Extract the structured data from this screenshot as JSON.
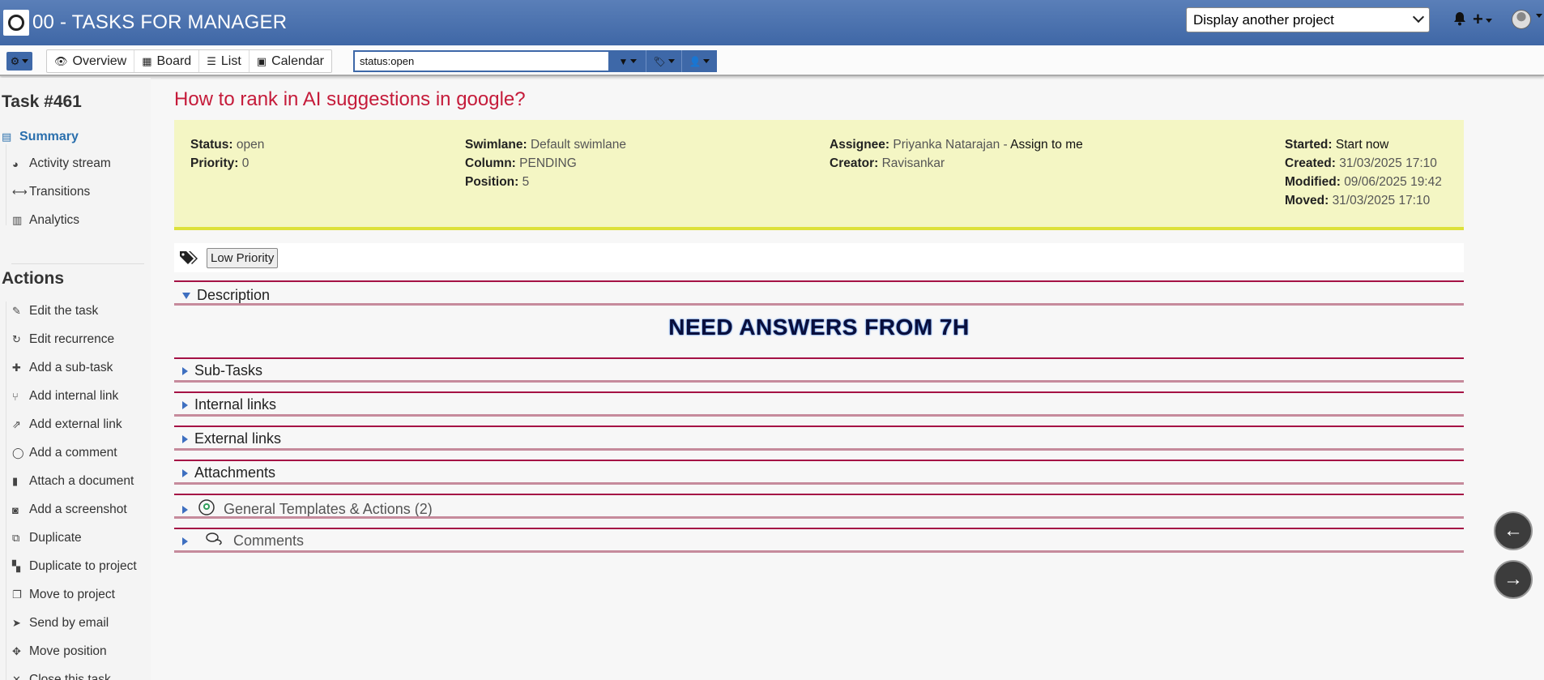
{
  "header": {
    "project_title": "00 - TASKS FOR MANAGER",
    "project_select": "Display another project"
  },
  "toolbar": {
    "views": [
      {
        "icon": "eye-icon",
        "label": "Overview"
      },
      {
        "icon": "board-icon",
        "label": "Board"
      },
      {
        "icon": "list-icon",
        "label": "List"
      },
      {
        "icon": "calendar-icon",
        "label": "Calendar"
      }
    ],
    "search_value": "status:open"
  },
  "sidebar": {
    "task_id": "Task #461",
    "summary_label": "Summary",
    "info_links": [
      "Activity stream",
      "Transitions",
      "Analytics"
    ],
    "actions_title": "Actions",
    "actions": [
      "Edit the task",
      "Edit recurrence",
      "Add a sub-task",
      "Add internal link",
      "Add external link",
      "Add a comment",
      "Attach a document",
      "Add a screenshot",
      "Duplicate",
      "Duplicate to project",
      "Move to project",
      "Send by email",
      "Move position",
      "Close this task"
    ]
  },
  "task": {
    "title": "How to rank in AI suggestions in google?",
    "status_label": "Status:",
    "status": "open",
    "priority_label": "Priority:",
    "priority": "0",
    "swimlane_label": "Swimlane:",
    "swimlane": "Default swimlane",
    "column_label": "Column:",
    "column": "PENDING",
    "position_label": "Position:",
    "position": "5",
    "assignee_label": "Assignee:",
    "assignee": "Priyanka Natarajan",
    "assign_sep": " - ",
    "assign_to_me": "Assign to me",
    "creator_label": "Creator:",
    "creator": "Ravisankar",
    "started_label": "Started:",
    "started": "Start now",
    "created_label": "Created:",
    "created": "31/03/2025 17:10",
    "modified_label": "Modified:",
    "modified": "09/06/2025 19:42",
    "moved_label": "Moved:",
    "moved": "31/03/2025 17:10",
    "tags": [
      "Low Priority"
    ],
    "description_text": "NEED ANSWERS FROM 7H"
  },
  "sections": {
    "description": "Description",
    "subtasks": "Sub-Tasks",
    "internal_links": "Internal links",
    "external_links": "External links",
    "attachments": "Attachments",
    "templates": "General Templates & Actions (2)",
    "comments": "Comments"
  },
  "nav": {
    "prev": "←",
    "next": "→"
  },
  "colors": {
    "header": "#3f67a6",
    "title": "#c51b3a",
    "summary_bg": "#f4f6c4",
    "accordion_line": "#a51245"
  }
}
